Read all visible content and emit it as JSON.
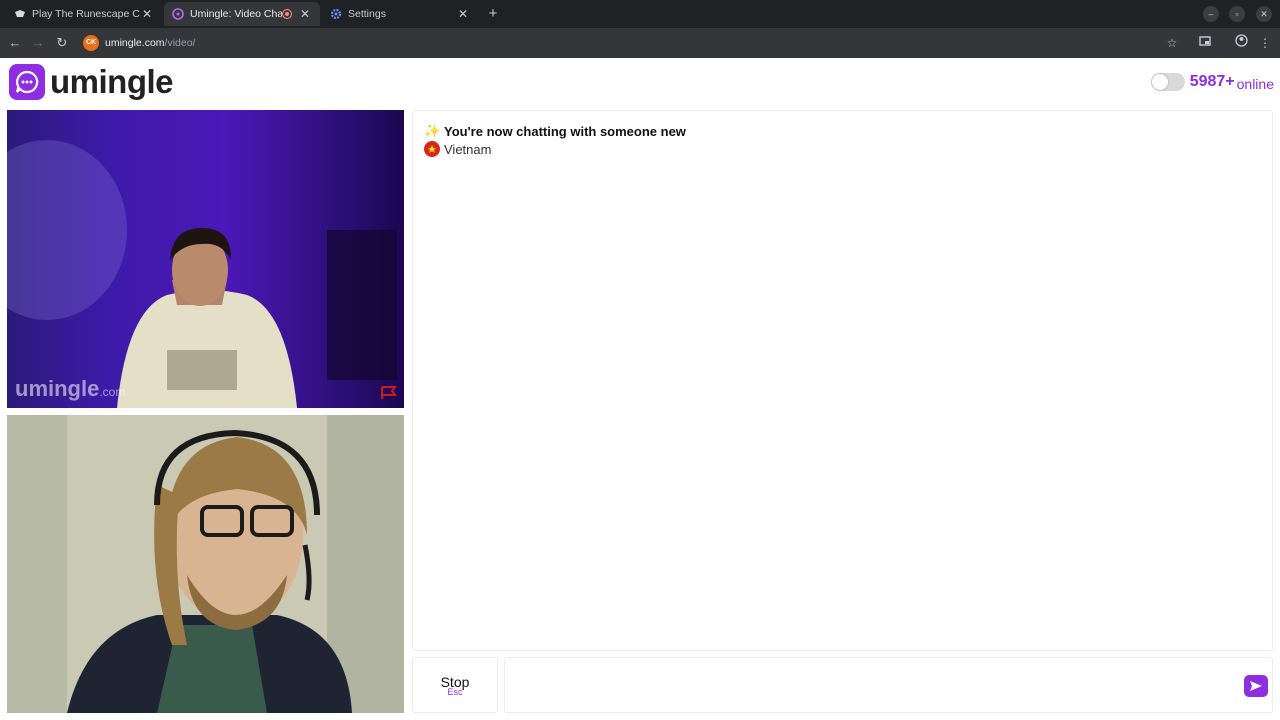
{
  "browser": {
    "tabs": [
      {
        "title": "Play The Runescape Cra",
        "icon": "runescape-icon"
      },
      {
        "title": "Umingle: Video Chat",
        "icon": "umingle-icon",
        "active": true,
        "recording": true
      },
      {
        "title": "Settings",
        "icon": "gear-icon"
      }
    ],
    "url_host": "umingle.com",
    "url_path": "/video/",
    "site_icon_text": "CK"
  },
  "header": {
    "logo_text": "umingle",
    "online_count": "5987+",
    "online_label": "online"
  },
  "videos": {
    "remote_watermark": "umingle",
    "remote_watermark_suffix": ".com"
  },
  "chat": {
    "status_message": "You're now chatting with someone new",
    "status_icon": "sparkles-icon",
    "partner_country": "Vietnam"
  },
  "controls": {
    "stop_label": "Stop",
    "stop_shortcut": "Esc",
    "message_placeholder": ""
  },
  "colors": {
    "brand": "#8e2de2",
    "report_flag": "#cc1a1a"
  }
}
